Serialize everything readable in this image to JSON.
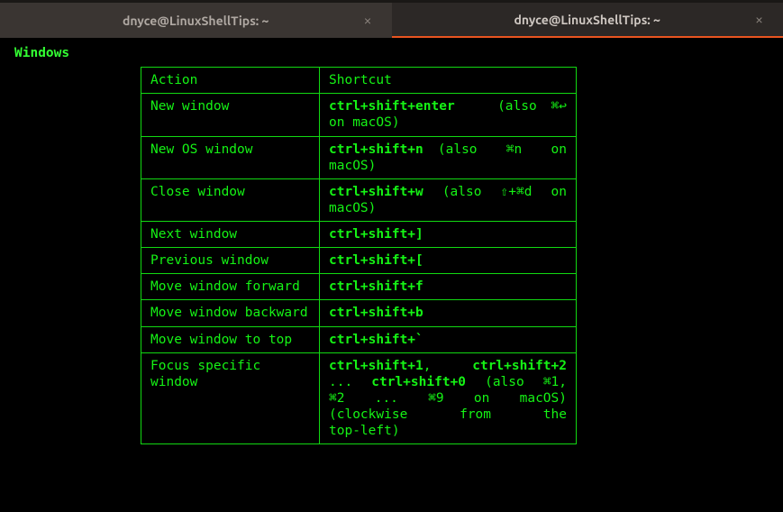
{
  "tabs": {
    "left": {
      "title": "dnyce@LinuxShellTips: ~"
    },
    "right": {
      "title": "dnyce@LinuxShellTips: ~"
    }
  },
  "section": {
    "title": "Windows"
  },
  "headers": {
    "action": "Action",
    "shortcut": "Shortcut"
  },
  "rows": {
    "r0": {
      "action": "New window",
      "sc": "ctrl+shift+enter",
      "sym": "⌘↩",
      "tail1": "(also",
      "tail2": "on macOS)"
    },
    "r1": {
      "action": "New OS window",
      "sc": "ctrl+shift+n",
      "tail1": "(also",
      "sym": "⌘n",
      "tail2": "on",
      "tail3": "macOS)"
    },
    "r2": {
      "action": "Close window",
      "sc": "ctrl+shift+w",
      "tail1": "(also",
      "sym": "⇧+⌘d",
      "tail2": "on",
      "tail3": "macOS)"
    },
    "r3": {
      "action": "Next window",
      "sc": "ctrl+shift+]"
    },
    "r4": {
      "action": "Previous window",
      "sc": "ctrl+shift+["
    },
    "r5": {
      "action": "Move window forward",
      "sc": "ctrl+shift+f"
    },
    "r6": {
      "action": "Move window backward",
      "sc": "ctrl+shift+b"
    },
    "r7": {
      "action": "Move window to top",
      "sc": "ctrl+shift+`"
    },
    "r8": {
      "action": "Focus specific window",
      "sc1": "ctrl+shift+1",
      "sep": ",",
      "sc2": "ctrl+shift+2",
      "dots": "...",
      "sc3": "ctrl+shift+0",
      "tail1": "(also",
      "sym1": "⌘1",
      "comma": ",",
      "sym2": "⌘2",
      "dots2": "...",
      "sym3": "⌘9",
      "on": "on",
      "mac": "macOS)",
      "line4a": "(clockwise",
      "line4b": "from",
      "line4c": "the",
      "line5": "top-left)"
    }
  }
}
